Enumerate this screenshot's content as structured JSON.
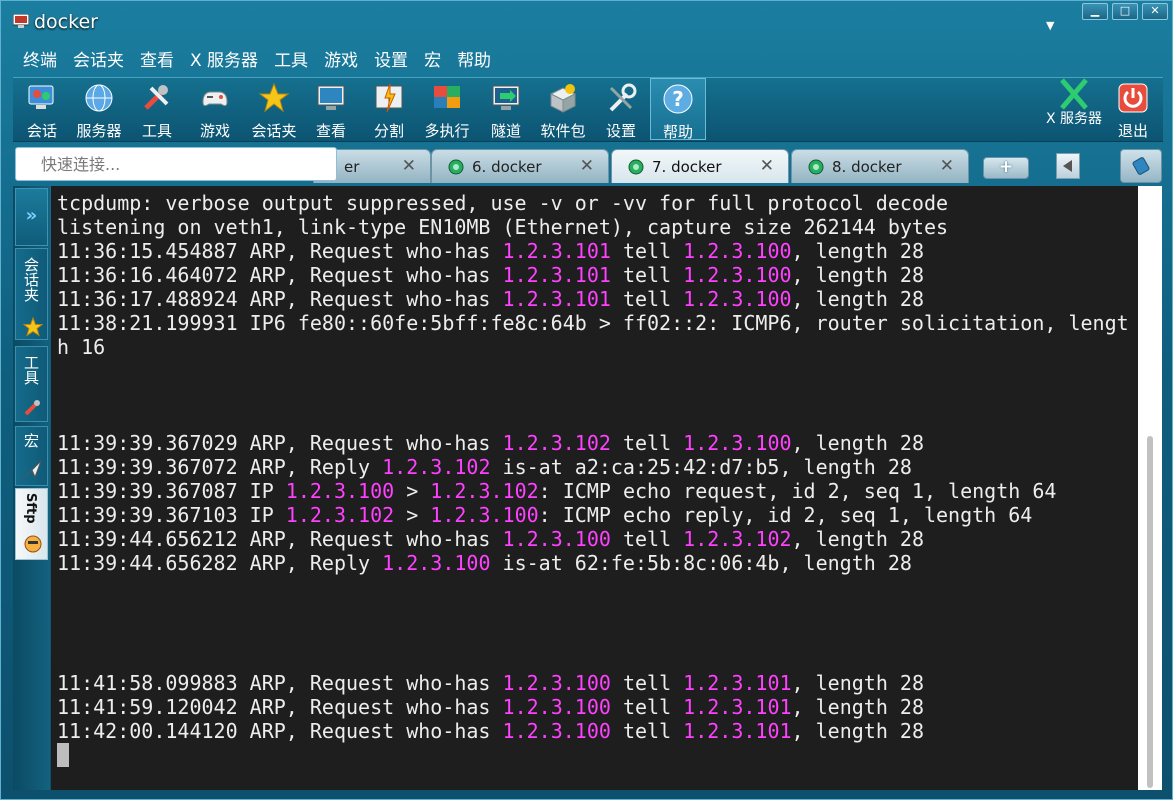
{
  "window": {
    "title": "docker",
    "controls": [
      "▁",
      "□",
      "✕"
    ]
  },
  "menu": [
    "终端",
    "会话夹",
    "查看",
    "X 服务器",
    "工具",
    "游戏",
    "设置",
    "宏",
    "帮助"
  ],
  "toolbar": {
    "items": [
      {
        "label": "会话",
        "icon": "session-icon"
      },
      {
        "label": "服务器",
        "icon": "globe-icon"
      },
      {
        "label": "工具",
        "icon": "tools-icon"
      },
      {
        "label": "游戏",
        "icon": "gamepad-icon"
      },
      {
        "label": "会话夹",
        "icon": "star-icon"
      },
      {
        "label": "查看",
        "icon": "monitor-icon"
      },
      {
        "label": "分割",
        "icon": "split-icon"
      },
      {
        "label": "多执行",
        "icon": "multiexec-icon"
      },
      {
        "label": "隧道",
        "icon": "tunnel-icon"
      },
      {
        "label": "软件包",
        "icon": "package-icon"
      },
      {
        "label": "设置",
        "icon": "wrench-icon"
      },
      {
        "label": "帮助",
        "icon": "help-icon"
      }
    ],
    "xserver_label": "X 服务器",
    "exit_label": "退出"
  },
  "quick_connect": {
    "placeholder": "快速连接..."
  },
  "tabs": [
    {
      "label": "er",
      "active": false
    },
    {
      "label": "6. docker",
      "active": false
    },
    {
      "label": "7. docker",
      "active": true
    },
    {
      "label": "8. docker",
      "active": false
    }
  ],
  "tab_close": "✕",
  "tab_add": "+",
  "sidebar": {
    "collapse": "»",
    "tabs": [
      {
        "label": "会话夹",
        "icon": "star-icon"
      },
      {
        "label": "工具",
        "icon": "tools-icon"
      },
      {
        "label": "宏",
        "icon": "paper-plane-icon"
      },
      {
        "label": "Sftp",
        "icon": "sftp-icon",
        "active": true
      }
    ]
  },
  "terminal": {
    "lines": [
      [
        {
          "t": "tcpdump: verbose output suppressed, use -v or -vv for full protocol decode"
        }
      ],
      [
        {
          "t": "listening on veth1, link-type EN10MB (Ethernet), capture size 262144 bytes"
        }
      ],
      [
        {
          "t": "11:36:15.454887 ARP, Request who-has "
        },
        {
          "t": "1.2.3.101",
          "h": 1
        },
        {
          "t": " tell "
        },
        {
          "t": "1.2.3.100",
          "h": 1
        },
        {
          "t": ", length 28"
        }
      ],
      [
        {
          "t": "11:36:16.464072 ARP, Request who-has "
        },
        {
          "t": "1.2.3.101",
          "h": 1
        },
        {
          "t": " tell "
        },
        {
          "t": "1.2.3.100",
          "h": 1
        },
        {
          "t": ", length 28"
        }
      ],
      [
        {
          "t": "11:36:17.488924 ARP, Request who-has "
        },
        {
          "t": "1.2.3.101",
          "h": 1
        },
        {
          "t": " tell "
        },
        {
          "t": "1.2.3.100",
          "h": 1
        },
        {
          "t": ", length 28"
        }
      ],
      [
        {
          "t": "11:38:21.199931 IP6 fe80::60fe:5bff:fe8c:64b > ff02::2: ICMP6, router solicitation, lengt"
        }
      ],
      [
        {
          "t": "h 16"
        }
      ],
      [],
      [],
      [],
      [
        {
          "t": "11:39:39.367029 ARP, Request who-has "
        },
        {
          "t": "1.2.3.102",
          "h": 1
        },
        {
          "t": " tell "
        },
        {
          "t": "1.2.3.100",
          "h": 1
        },
        {
          "t": ", length 28"
        }
      ],
      [
        {
          "t": "11:39:39.367072 ARP, Reply "
        },
        {
          "t": "1.2.3.102",
          "h": 1
        },
        {
          "t": " is-at a2:ca:25:42:d7:b5, length 28"
        }
      ],
      [
        {
          "t": "11:39:39.367087 IP "
        },
        {
          "t": "1.2.3.100",
          "h": 1
        },
        {
          "t": " > "
        },
        {
          "t": "1.2.3.102",
          "h": 1
        },
        {
          "t": ": ICMP echo request, id 2, seq 1, length 64"
        }
      ],
      [
        {
          "t": "11:39:39.367103 IP "
        },
        {
          "t": "1.2.3.102",
          "h": 1
        },
        {
          "t": " > "
        },
        {
          "t": "1.2.3.100",
          "h": 1
        },
        {
          "t": ": ICMP echo reply, id 2, seq 1, length 64"
        }
      ],
      [
        {
          "t": "11:39:44.656212 ARP, Request who-has "
        },
        {
          "t": "1.2.3.100",
          "h": 1
        },
        {
          "t": " tell "
        },
        {
          "t": "1.2.3.102",
          "h": 1
        },
        {
          "t": ", length 28"
        }
      ],
      [
        {
          "t": "11:39:44.656282 ARP, Reply "
        },
        {
          "t": "1.2.3.100",
          "h": 1
        },
        {
          "t": " is-at 62:fe:5b:8c:06:4b, length 28"
        }
      ],
      [],
      [],
      [],
      [],
      [
        {
          "t": "11:41:58.099883 ARP, Request who-has "
        },
        {
          "t": "1.2.3.100",
          "h": 1
        },
        {
          "t": " tell "
        },
        {
          "t": "1.2.3.101",
          "h": 1
        },
        {
          "t": ", length 28"
        }
      ],
      [
        {
          "t": "11:41:59.120042 ARP, Request who-has "
        },
        {
          "t": "1.2.3.100",
          "h": 1
        },
        {
          "t": " tell "
        },
        {
          "t": "1.2.3.101",
          "h": 1
        },
        {
          "t": ", length 28"
        }
      ],
      [
        {
          "t": "11:42:00.144120 ARP, Request who-has "
        },
        {
          "t": "1.2.3.100",
          "h": 1
        },
        {
          "t": " tell "
        },
        {
          "t": "1.2.3.101",
          "h": 1
        },
        {
          "t": ", length 28"
        }
      ]
    ],
    "colors": {
      "background": "#1e1e1e",
      "foreground": "#ededed",
      "highlight": "#ff40ff"
    }
  }
}
